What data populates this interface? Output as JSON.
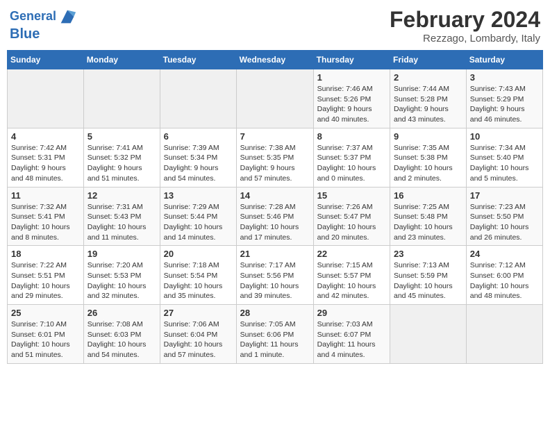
{
  "header": {
    "logo_line1": "General",
    "logo_line2": "Blue",
    "month_title": "February 2024",
    "location": "Rezzago, Lombardy, Italy"
  },
  "weekdays": [
    "Sunday",
    "Monday",
    "Tuesday",
    "Wednesday",
    "Thursday",
    "Friday",
    "Saturday"
  ],
  "weeks": [
    [
      {
        "day": "",
        "info": ""
      },
      {
        "day": "",
        "info": ""
      },
      {
        "day": "",
        "info": ""
      },
      {
        "day": "",
        "info": ""
      },
      {
        "day": "1",
        "info": "Sunrise: 7:46 AM\nSunset: 5:26 PM\nDaylight: 9 hours\nand 40 minutes."
      },
      {
        "day": "2",
        "info": "Sunrise: 7:44 AM\nSunset: 5:28 PM\nDaylight: 9 hours\nand 43 minutes."
      },
      {
        "day": "3",
        "info": "Sunrise: 7:43 AM\nSunset: 5:29 PM\nDaylight: 9 hours\nand 46 minutes."
      }
    ],
    [
      {
        "day": "4",
        "info": "Sunrise: 7:42 AM\nSunset: 5:31 PM\nDaylight: 9 hours\nand 48 minutes."
      },
      {
        "day": "5",
        "info": "Sunrise: 7:41 AM\nSunset: 5:32 PM\nDaylight: 9 hours\nand 51 minutes."
      },
      {
        "day": "6",
        "info": "Sunrise: 7:39 AM\nSunset: 5:34 PM\nDaylight: 9 hours\nand 54 minutes."
      },
      {
        "day": "7",
        "info": "Sunrise: 7:38 AM\nSunset: 5:35 PM\nDaylight: 9 hours\nand 57 minutes."
      },
      {
        "day": "8",
        "info": "Sunrise: 7:37 AM\nSunset: 5:37 PM\nDaylight: 10 hours\nand 0 minutes."
      },
      {
        "day": "9",
        "info": "Sunrise: 7:35 AM\nSunset: 5:38 PM\nDaylight: 10 hours\nand 2 minutes."
      },
      {
        "day": "10",
        "info": "Sunrise: 7:34 AM\nSunset: 5:40 PM\nDaylight: 10 hours\nand 5 minutes."
      }
    ],
    [
      {
        "day": "11",
        "info": "Sunrise: 7:32 AM\nSunset: 5:41 PM\nDaylight: 10 hours\nand 8 minutes."
      },
      {
        "day": "12",
        "info": "Sunrise: 7:31 AM\nSunset: 5:43 PM\nDaylight: 10 hours\nand 11 minutes."
      },
      {
        "day": "13",
        "info": "Sunrise: 7:29 AM\nSunset: 5:44 PM\nDaylight: 10 hours\nand 14 minutes."
      },
      {
        "day": "14",
        "info": "Sunrise: 7:28 AM\nSunset: 5:46 PM\nDaylight: 10 hours\nand 17 minutes."
      },
      {
        "day": "15",
        "info": "Sunrise: 7:26 AM\nSunset: 5:47 PM\nDaylight: 10 hours\nand 20 minutes."
      },
      {
        "day": "16",
        "info": "Sunrise: 7:25 AM\nSunset: 5:48 PM\nDaylight: 10 hours\nand 23 minutes."
      },
      {
        "day": "17",
        "info": "Sunrise: 7:23 AM\nSunset: 5:50 PM\nDaylight: 10 hours\nand 26 minutes."
      }
    ],
    [
      {
        "day": "18",
        "info": "Sunrise: 7:22 AM\nSunset: 5:51 PM\nDaylight: 10 hours\nand 29 minutes."
      },
      {
        "day": "19",
        "info": "Sunrise: 7:20 AM\nSunset: 5:53 PM\nDaylight: 10 hours\nand 32 minutes."
      },
      {
        "day": "20",
        "info": "Sunrise: 7:18 AM\nSunset: 5:54 PM\nDaylight: 10 hours\nand 35 minutes."
      },
      {
        "day": "21",
        "info": "Sunrise: 7:17 AM\nSunset: 5:56 PM\nDaylight: 10 hours\nand 39 minutes."
      },
      {
        "day": "22",
        "info": "Sunrise: 7:15 AM\nSunset: 5:57 PM\nDaylight: 10 hours\nand 42 minutes."
      },
      {
        "day": "23",
        "info": "Sunrise: 7:13 AM\nSunset: 5:59 PM\nDaylight: 10 hours\nand 45 minutes."
      },
      {
        "day": "24",
        "info": "Sunrise: 7:12 AM\nSunset: 6:00 PM\nDaylight: 10 hours\nand 48 minutes."
      }
    ],
    [
      {
        "day": "25",
        "info": "Sunrise: 7:10 AM\nSunset: 6:01 PM\nDaylight: 10 hours\nand 51 minutes."
      },
      {
        "day": "26",
        "info": "Sunrise: 7:08 AM\nSunset: 6:03 PM\nDaylight: 10 hours\nand 54 minutes."
      },
      {
        "day": "27",
        "info": "Sunrise: 7:06 AM\nSunset: 6:04 PM\nDaylight: 10 hours\nand 57 minutes."
      },
      {
        "day": "28",
        "info": "Sunrise: 7:05 AM\nSunset: 6:06 PM\nDaylight: 11 hours\nand 1 minute."
      },
      {
        "day": "29",
        "info": "Sunrise: 7:03 AM\nSunset: 6:07 PM\nDaylight: 11 hours\nand 4 minutes."
      },
      {
        "day": "",
        "info": ""
      },
      {
        "day": "",
        "info": ""
      }
    ]
  ]
}
